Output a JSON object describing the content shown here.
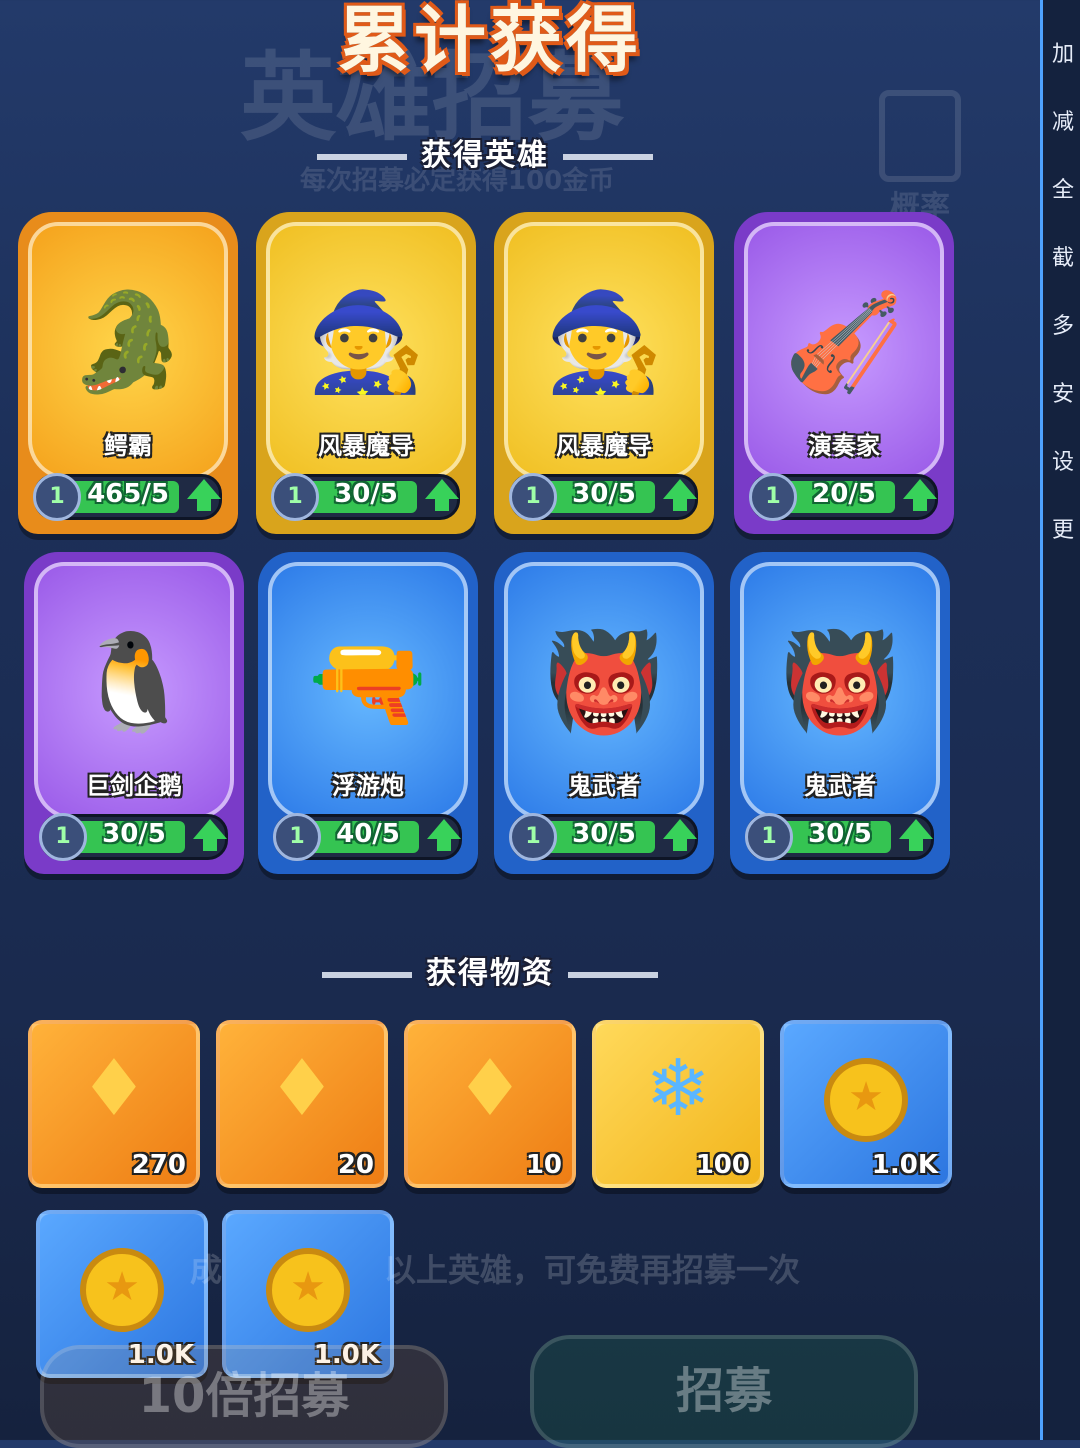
{
  "title": "累计获得",
  "ghost_text": {
    "bg_title": "英雄招募",
    "subtitle": "每次招募必定获得100金币",
    "probability": "概率",
    "hint": "以上英雄，可免费再招募一次",
    "hint_prefix": "成",
    "btn_left": "10倍招募",
    "btn_right": "招募"
  },
  "heroes_section": {
    "title": "获得英雄"
  },
  "heroes": [
    {
      "name": "鳄霸",
      "level": "1",
      "count": "465/5",
      "rarity": "orange"
    },
    {
      "name": "风暴魔导",
      "level": "1",
      "count": "30/5",
      "rarity": "yellow"
    },
    {
      "name": "风暴魔导",
      "level": "1",
      "count": "30/5",
      "rarity": "yellow"
    },
    {
      "name": "演奏家",
      "level": "1",
      "count": "20/5",
      "rarity": "purple"
    },
    {
      "name": "巨剑企鹅",
      "level": "1",
      "count": "30/5",
      "rarity": "purple"
    },
    {
      "name": "浮游炮",
      "level": "1",
      "count": "40/5",
      "rarity": "blue"
    },
    {
      "name": "鬼武者",
      "level": "1",
      "count": "30/5",
      "rarity": "blue"
    },
    {
      "name": "鬼武者",
      "level": "1",
      "count": "30/5",
      "rarity": "blue"
    }
  ],
  "items_section": {
    "title": "获得物资"
  },
  "items": [
    {
      "icon": "orange-crystal-icon",
      "qty": "270"
    },
    {
      "icon": "orange-crystal-icon",
      "qty": "20"
    },
    {
      "icon": "orange-crystal-icon",
      "qty": "10"
    },
    {
      "icon": "blue-snowflake-icon",
      "qty": "100"
    },
    {
      "icon": "gold-coin-icon",
      "qty": "1.0K"
    },
    {
      "icon": "gold-coin-icon",
      "qty": "1.0K"
    },
    {
      "icon": "gold-coin-icon",
      "qty": "1.0K"
    }
  ],
  "side_panel": [
    "加",
    "减",
    "全",
    "截",
    "多",
    "安",
    "设",
    "更"
  ]
}
